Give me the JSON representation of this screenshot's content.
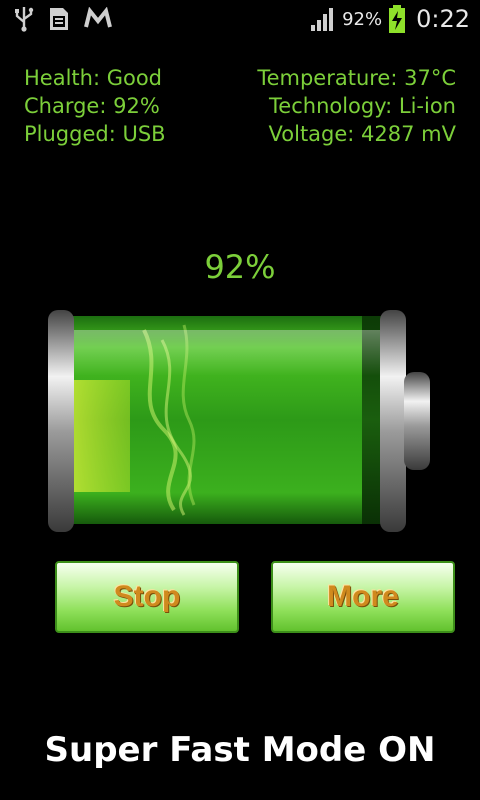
{
  "status_bar": {
    "icons": [
      "usb-icon",
      "sd-card-icon",
      "gmail-icon",
      "signal-icon",
      "battery-charging-icon"
    ],
    "battery_percent": "92%",
    "time": "0:22"
  },
  "info": {
    "health": "Health: Good",
    "charge": "Charge: 92%",
    "plugged": "Plugged: USB",
    "temperature": "Temperature: 37°C",
    "technology": "Technology: Li-ion",
    "voltage": "Voltage: 4287 mV"
  },
  "battery": {
    "percent_label": "92%",
    "level": 0.92
  },
  "buttons": {
    "stop": "Stop",
    "more": "More"
  },
  "mode_text": "Super Fast Mode ON",
  "colors": {
    "info_text": "#7ccf3a",
    "button_text": "#d08a1e",
    "battery_fill": "#3fb21c"
  }
}
